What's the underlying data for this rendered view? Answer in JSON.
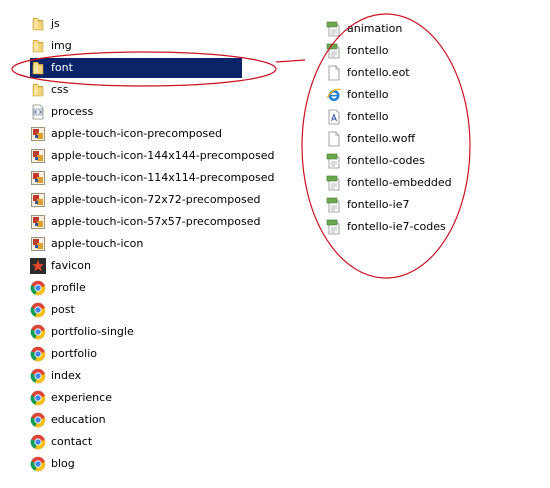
{
  "left_items": [
    {
      "name": "js",
      "icon": "folder-icon"
    },
    {
      "name": "img",
      "icon": "folder-icon"
    },
    {
      "name": "font",
      "icon": "folder-icon",
      "selected": true
    },
    {
      "name": "css",
      "icon": "folder-icon"
    },
    {
      "name": "process",
      "icon": "script-file-icon"
    },
    {
      "name": "apple-touch-icon-precomposed",
      "icon": "image-file-icon"
    },
    {
      "name": "apple-touch-icon-144x144-precomposed",
      "icon": "image-file-icon"
    },
    {
      "name": "apple-touch-icon-114x114-precomposed",
      "icon": "image-file-icon"
    },
    {
      "name": "apple-touch-icon-72x72-precomposed",
      "icon": "image-file-icon"
    },
    {
      "name": "apple-touch-icon-57x57-precomposed",
      "icon": "image-file-icon"
    },
    {
      "name": "apple-touch-icon",
      "icon": "image-file-icon"
    },
    {
      "name": "favicon",
      "icon": "star-icon"
    },
    {
      "name": "profile",
      "icon": "chrome-icon"
    },
    {
      "name": "post",
      "icon": "chrome-icon"
    },
    {
      "name": "portfolio-single",
      "icon": "chrome-icon"
    },
    {
      "name": "portfolio",
      "icon": "chrome-icon"
    },
    {
      "name": "index",
      "icon": "chrome-icon"
    },
    {
      "name": "experience",
      "icon": "chrome-icon"
    },
    {
      "name": "education",
      "icon": "chrome-icon"
    },
    {
      "name": "contact",
      "icon": "chrome-icon"
    },
    {
      "name": "blog",
      "icon": "chrome-icon"
    }
  ],
  "right_items": [
    {
      "name": "animation",
      "icon": "css-file-icon"
    },
    {
      "name": "fontello",
      "icon": "css-file-icon"
    },
    {
      "name": "fontello.eot",
      "icon": "blank-file-icon"
    },
    {
      "name": "fontello",
      "icon": "ie-icon"
    },
    {
      "name": "fontello",
      "icon": "font-file-icon"
    },
    {
      "name": "fontello.woff",
      "icon": "blank-file-icon"
    },
    {
      "name": "fontello-codes",
      "icon": "css-file-icon"
    },
    {
      "name": "fontello-embedded",
      "icon": "css-file-icon"
    },
    {
      "name": "fontello-ie7",
      "icon": "css-file-icon"
    },
    {
      "name": "fontello-ie7-codes",
      "icon": "css-file-icon"
    }
  ],
  "colors": {
    "selection": "#0a246a",
    "annotation": "#cc1122",
    "folder": "#e8c25a"
  }
}
